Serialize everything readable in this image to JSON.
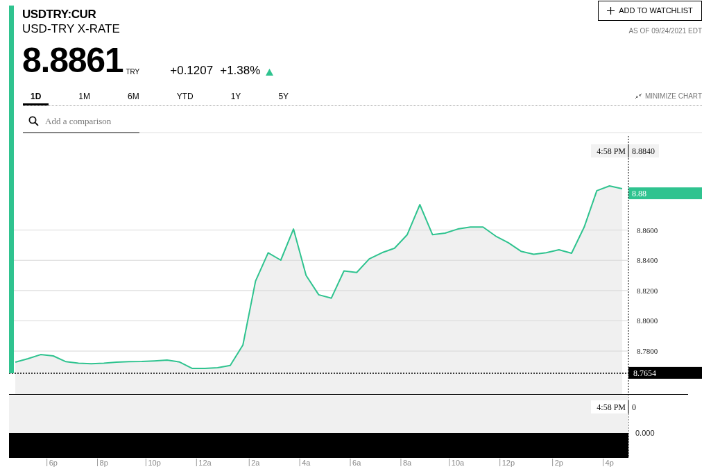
{
  "header": {
    "symbol": "USDTRY:CUR",
    "name": "USD-TRY X-RATE",
    "watchlist_button": "ADD TO WATCHLIST",
    "as_of": "AS OF 09/24/2021 EDT"
  },
  "quote": {
    "price": "8.8861",
    "currency": "TRY",
    "change": "+0.1207",
    "change_percent": "+1.38%",
    "rising": true
  },
  "range_tabs": [
    {
      "label": "1D",
      "selected": true
    },
    {
      "label": "1M",
      "selected": false
    },
    {
      "label": "6M",
      "selected": false
    },
    {
      "label": "YTD",
      "selected": false
    },
    {
      "label": "1Y",
      "selected": false
    },
    {
      "label": "5Y",
      "selected": false
    }
  ],
  "minimize_chart": "MINIMIZE CHART",
  "comparison_search": {
    "placeholder": "Add a comparison"
  },
  "price_chart": {
    "chart_data": {
      "type": "area",
      "ylim": [
        8.7094,
        8.9222
      ],
      "grid": true,
      "ref_lines": [
        {
          "axis": "y",
          "value": 8.7654,
          "label": "8.7654"
        }
      ],
      "categories": [
        null,
        null,
        null,
        "6p",
        null,
        null,
        null,
        "8p",
        null,
        null,
        null,
        "10p",
        null,
        null,
        null,
        "12a",
        null,
        null,
        null,
        "2a",
        null,
        null,
        null,
        "4a",
        null,
        null,
        null,
        "6a",
        null,
        null,
        null,
        "8a",
        null,
        null,
        null,
        "10a",
        null,
        null,
        null,
        "12p",
        null,
        null,
        null,
        "2p",
        null,
        null,
        null,
        "4p",
        null
      ],
      "yticks": [
        {
          "value": 8.78,
          "label": "8.7800"
        },
        {
          "value": 8.8,
          "label": "8.8000"
        },
        {
          "value": 8.82,
          "label": "8.8200"
        },
        {
          "value": 8.84,
          "label": "8.8400"
        },
        {
          "value": 8.86,
          "label": "8.8600"
        }
      ],
      "series": [
        {
          "color": "#2fc38f",
          "values": [
            8.7727,
            8.775,
            8.7777,
            8.7768,
            8.773,
            8.772,
            8.7717,
            8.772,
            8.7727,
            8.773,
            8.7731,
            8.7735,
            8.774,
            8.7728,
            8.7685,
            8.7685,
            8.769,
            8.7705,
            8.784,
            8.8263,
            8.845,
            8.8401,
            8.8607,
            8.83,
            8.8172,
            8.815,
            8.833,
            8.832,
            8.841,
            8.845,
            8.848,
            8.857,
            8.8768,
            8.857,
            8.858,
            8.8607,
            8.862,
            8.862,
            8.856,
            8.8516,
            8.846,
            8.844,
            8.845,
            8.847,
            8.8447,
            8.862,
            8.886,
            8.8892,
            8.8873
          ]
        }
      ]
    },
    "crosshair": {
      "time": "4:58 PM",
      "value": "8.8840"
    },
    "last_price_label": "8.88"
  },
  "volume_chart": {
    "crosshair": {
      "time": "4:58 PM",
      "value": "0"
    },
    "ytick_label": "0.000"
  }
}
